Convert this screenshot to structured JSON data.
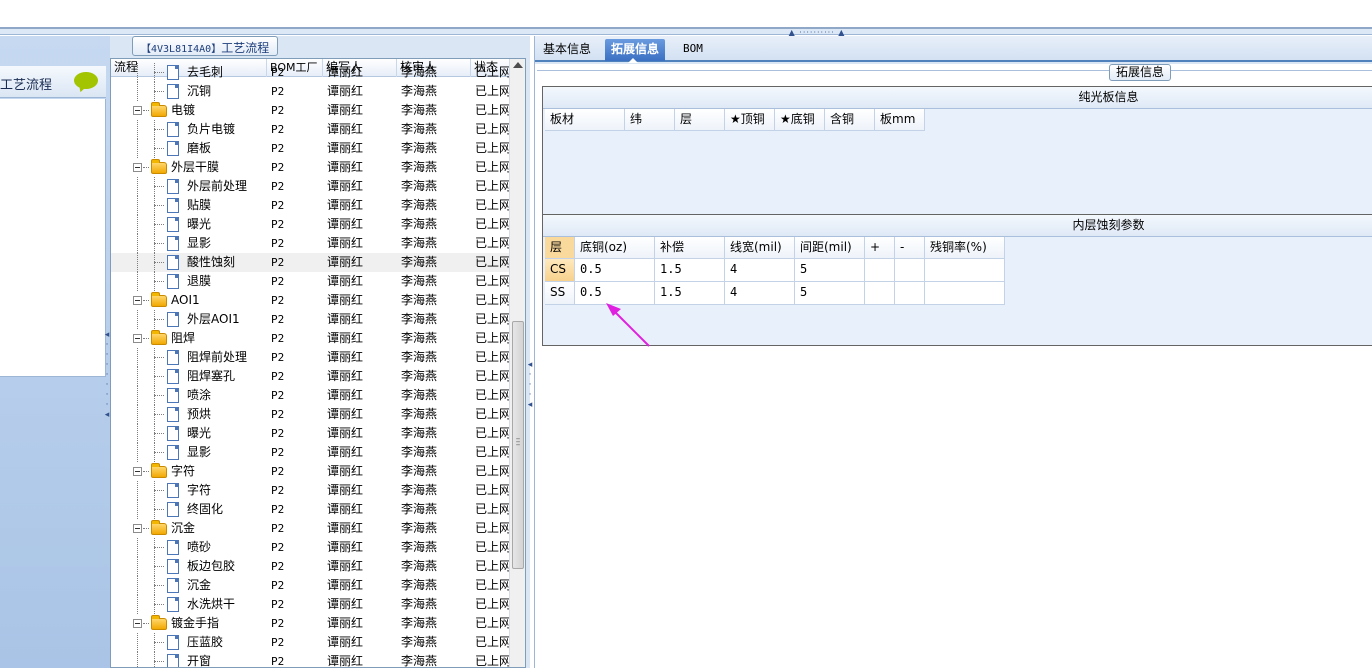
{
  "left": {
    "header_label": "工艺流程"
  },
  "mid": {
    "tab_code": "【4V3L81I4A0】",
    "tab_title": "工艺流程",
    "columns": [
      "流程",
      "BOM工厂",
      "编写人",
      "核审人",
      "状态"
    ],
    "rows": [
      {
        "label": "去毛刺",
        "type": "doc",
        "factory": "P2",
        "writer": "谭丽红",
        "reviewer": "李海燕",
        "status": "已上网"
      },
      {
        "label": "沉铜",
        "type": "doc",
        "factory": "P2",
        "writer": "谭丽红",
        "reviewer": "李海燕",
        "status": "已上网"
      },
      {
        "label": "电镀",
        "type": "folder",
        "factory": "P2",
        "writer": "谭丽红",
        "reviewer": "李海燕",
        "status": "已上网"
      },
      {
        "label": "负片电镀",
        "type": "doc",
        "factory": "P2",
        "writer": "谭丽红",
        "reviewer": "李海燕",
        "status": "已上网"
      },
      {
        "label": "磨板",
        "type": "doc",
        "factory": "P2",
        "writer": "谭丽红",
        "reviewer": "李海燕",
        "status": "已上网"
      },
      {
        "label": "外层干膜",
        "type": "folder",
        "factory": "P2",
        "writer": "谭丽红",
        "reviewer": "李海燕",
        "status": "已上网"
      },
      {
        "label": "外层前处理",
        "type": "doc",
        "factory": "P2",
        "writer": "谭丽红",
        "reviewer": "李海燕",
        "status": "已上网"
      },
      {
        "label": "贴膜",
        "type": "doc",
        "factory": "P2",
        "writer": "谭丽红",
        "reviewer": "李海燕",
        "status": "已上网"
      },
      {
        "label": "曝光",
        "type": "doc",
        "factory": "P2",
        "writer": "谭丽红",
        "reviewer": "李海燕",
        "status": "已上网"
      },
      {
        "label": "显影",
        "type": "doc",
        "factory": "P2",
        "writer": "谭丽红",
        "reviewer": "李海燕",
        "status": "已上网"
      },
      {
        "label": "酸性蚀刻",
        "type": "doc",
        "factory": "P2",
        "writer": "谭丽红",
        "reviewer": "李海燕",
        "status": "已上网",
        "selected": true
      },
      {
        "label": "退膜",
        "type": "doc",
        "factory": "P2",
        "writer": "谭丽红",
        "reviewer": "李海燕",
        "status": "已上网"
      },
      {
        "label": "AOI1",
        "type": "folder",
        "factory": "P2",
        "writer": "谭丽红",
        "reviewer": "李海燕",
        "status": "已上网"
      },
      {
        "label": "外层AOI1",
        "type": "doc",
        "factory": "P2",
        "writer": "谭丽红",
        "reviewer": "李海燕",
        "status": "已上网"
      },
      {
        "label": "阻焊",
        "type": "folder",
        "factory": "P2",
        "writer": "谭丽红",
        "reviewer": "李海燕",
        "status": "已上网"
      },
      {
        "label": "阻焊前处理",
        "type": "doc",
        "factory": "P2",
        "writer": "谭丽红",
        "reviewer": "李海燕",
        "status": "已上网"
      },
      {
        "label": "阻焊塞孔",
        "type": "doc",
        "factory": "P2",
        "writer": "谭丽红",
        "reviewer": "李海燕",
        "status": "已上网"
      },
      {
        "label": "喷涂",
        "type": "doc",
        "factory": "P2",
        "writer": "谭丽红",
        "reviewer": "李海燕",
        "status": "已上网"
      },
      {
        "label": "预烘",
        "type": "doc",
        "factory": "P2",
        "writer": "谭丽红",
        "reviewer": "李海燕",
        "status": "已上网"
      },
      {
        "label": "曝光",
        "type": "doc",
        "factory": "P2",
        "writer": "谭丽红",
        "reviewer": "李海燕",
        "status": "已上网"
      },
      {
        "label": "显影",
        "type": "doc",
        "factory": "P2",
        "writer": "谭丽红",
        "reviewer": "李海燕",
        "status": "已上网"
      },
      {
        "label": "字符",
        "type": "folder",
        "factory": "P2",
        "writer": "谭丽红",
        "reviewer": "李海燕",
        "status": "已上网"
      },
      {
        "label": "字符",
        "type": "doc",
        "factory": "P2",
        "writer": "谭丽红",
        "reviewer": "李海燕",
        "status": "已上网"
      },
      {
        "label": "终固化",
        "type": "doc",
        "factory": "P2",
        "writer": "谭丽红",
        "reviewer": "李海燕",
        "status": "已上网"
      },
      {
        "label": "沉金",
        "type": "folder",
        "factory": "P2",
        "writer": "谭丽红",
        "reviewer": "李海燕",
        "status": "已上网"
      },
      {
        "label": "喷砂",
        "type": "doc",
        "factory": "P2",
        "writer": "谭丽红",
        "reviewer": "李海燕",
        "status": "已上网"
      },
      {
        "label": "板边包胶",
        "type": "doc",
        "factory": "P2",
        "writer": "谭丽红",
        "reviewer": "李海燕",
        "status": "已上网"
      },
      {
        "label": "沉金",
        "type": "doc",
        "factory": "P2",
        "writer": "谭丽红",
        "reviewer": "李海燕",
        "status": "已上网"
      },
      {
        "label": "水洗烘干",
        "type": "doc",
        "factory": "P2",
        "writer": "谭丽红",
        "reviewer": "李海燕",
        "status": "已上网"
      },
      {
        "label": "镀金手指",
        "type": "folder",
        "factory": "P2",
        "writer": "谭丽红",
        "reviewer": "李海燕",
        "status": "已上网"
      },
      {
        "label": "压蓝胶",
        "type": "doc",
        "factory": "P2",
        "writer": "谭丽红",
        "reviewer": "李海燕",
        "status": "已上网"
      },
      {
        "label": "开窗",
        "type": "doc",
        "factory": "P2",
        "writer": "谭丽红",
        "reviewer": "李海燕",
        "status": "已上网"
      }
    ]
  },
  "right": {
    "tabs": [
      "基本信息",
      "拓展信息",
      "BOM"
    ],
    "active_tab": 1,
    "group_title": "拓展信息",
    "section1": {
      "title": "纯光板信息",
      "columns": [
        "板材",
        "纬",
        "层",
        "★顶铜",
        "★底铜",
        "含铜",
        "板mm"
      ]
    },
    "section2": {
      "title": "内层蚀刻参数",
      "columns": [
        "层",
        "底铜(oz)",
        "补偿",
        "线宽(mil)",
        "间距(mil)",
        "+",
        "-",
        "残铜率(%)"
      ],
      "rows": [
        {
          "layer": "CS",
          "base_copper": "0.5",
          "comp": "1.5",
          "line_width": "4",
          "spacing": "5",
          "plus": "",
          "minus": "",
          "residual": ""
        },
        {
          "layer": "SS",
          "base_copper": "0.5",
          "comp": "1.5",
          "line_width": "4",
          "spacing": "5",
          "plus": "",
          "minus": "",
          "residual": ""
        }
      ]
    }
  },
  "colors": {
    "accent": "#3a6fc2",
    "annotation_arrow": "#e020e0"
  }
}
